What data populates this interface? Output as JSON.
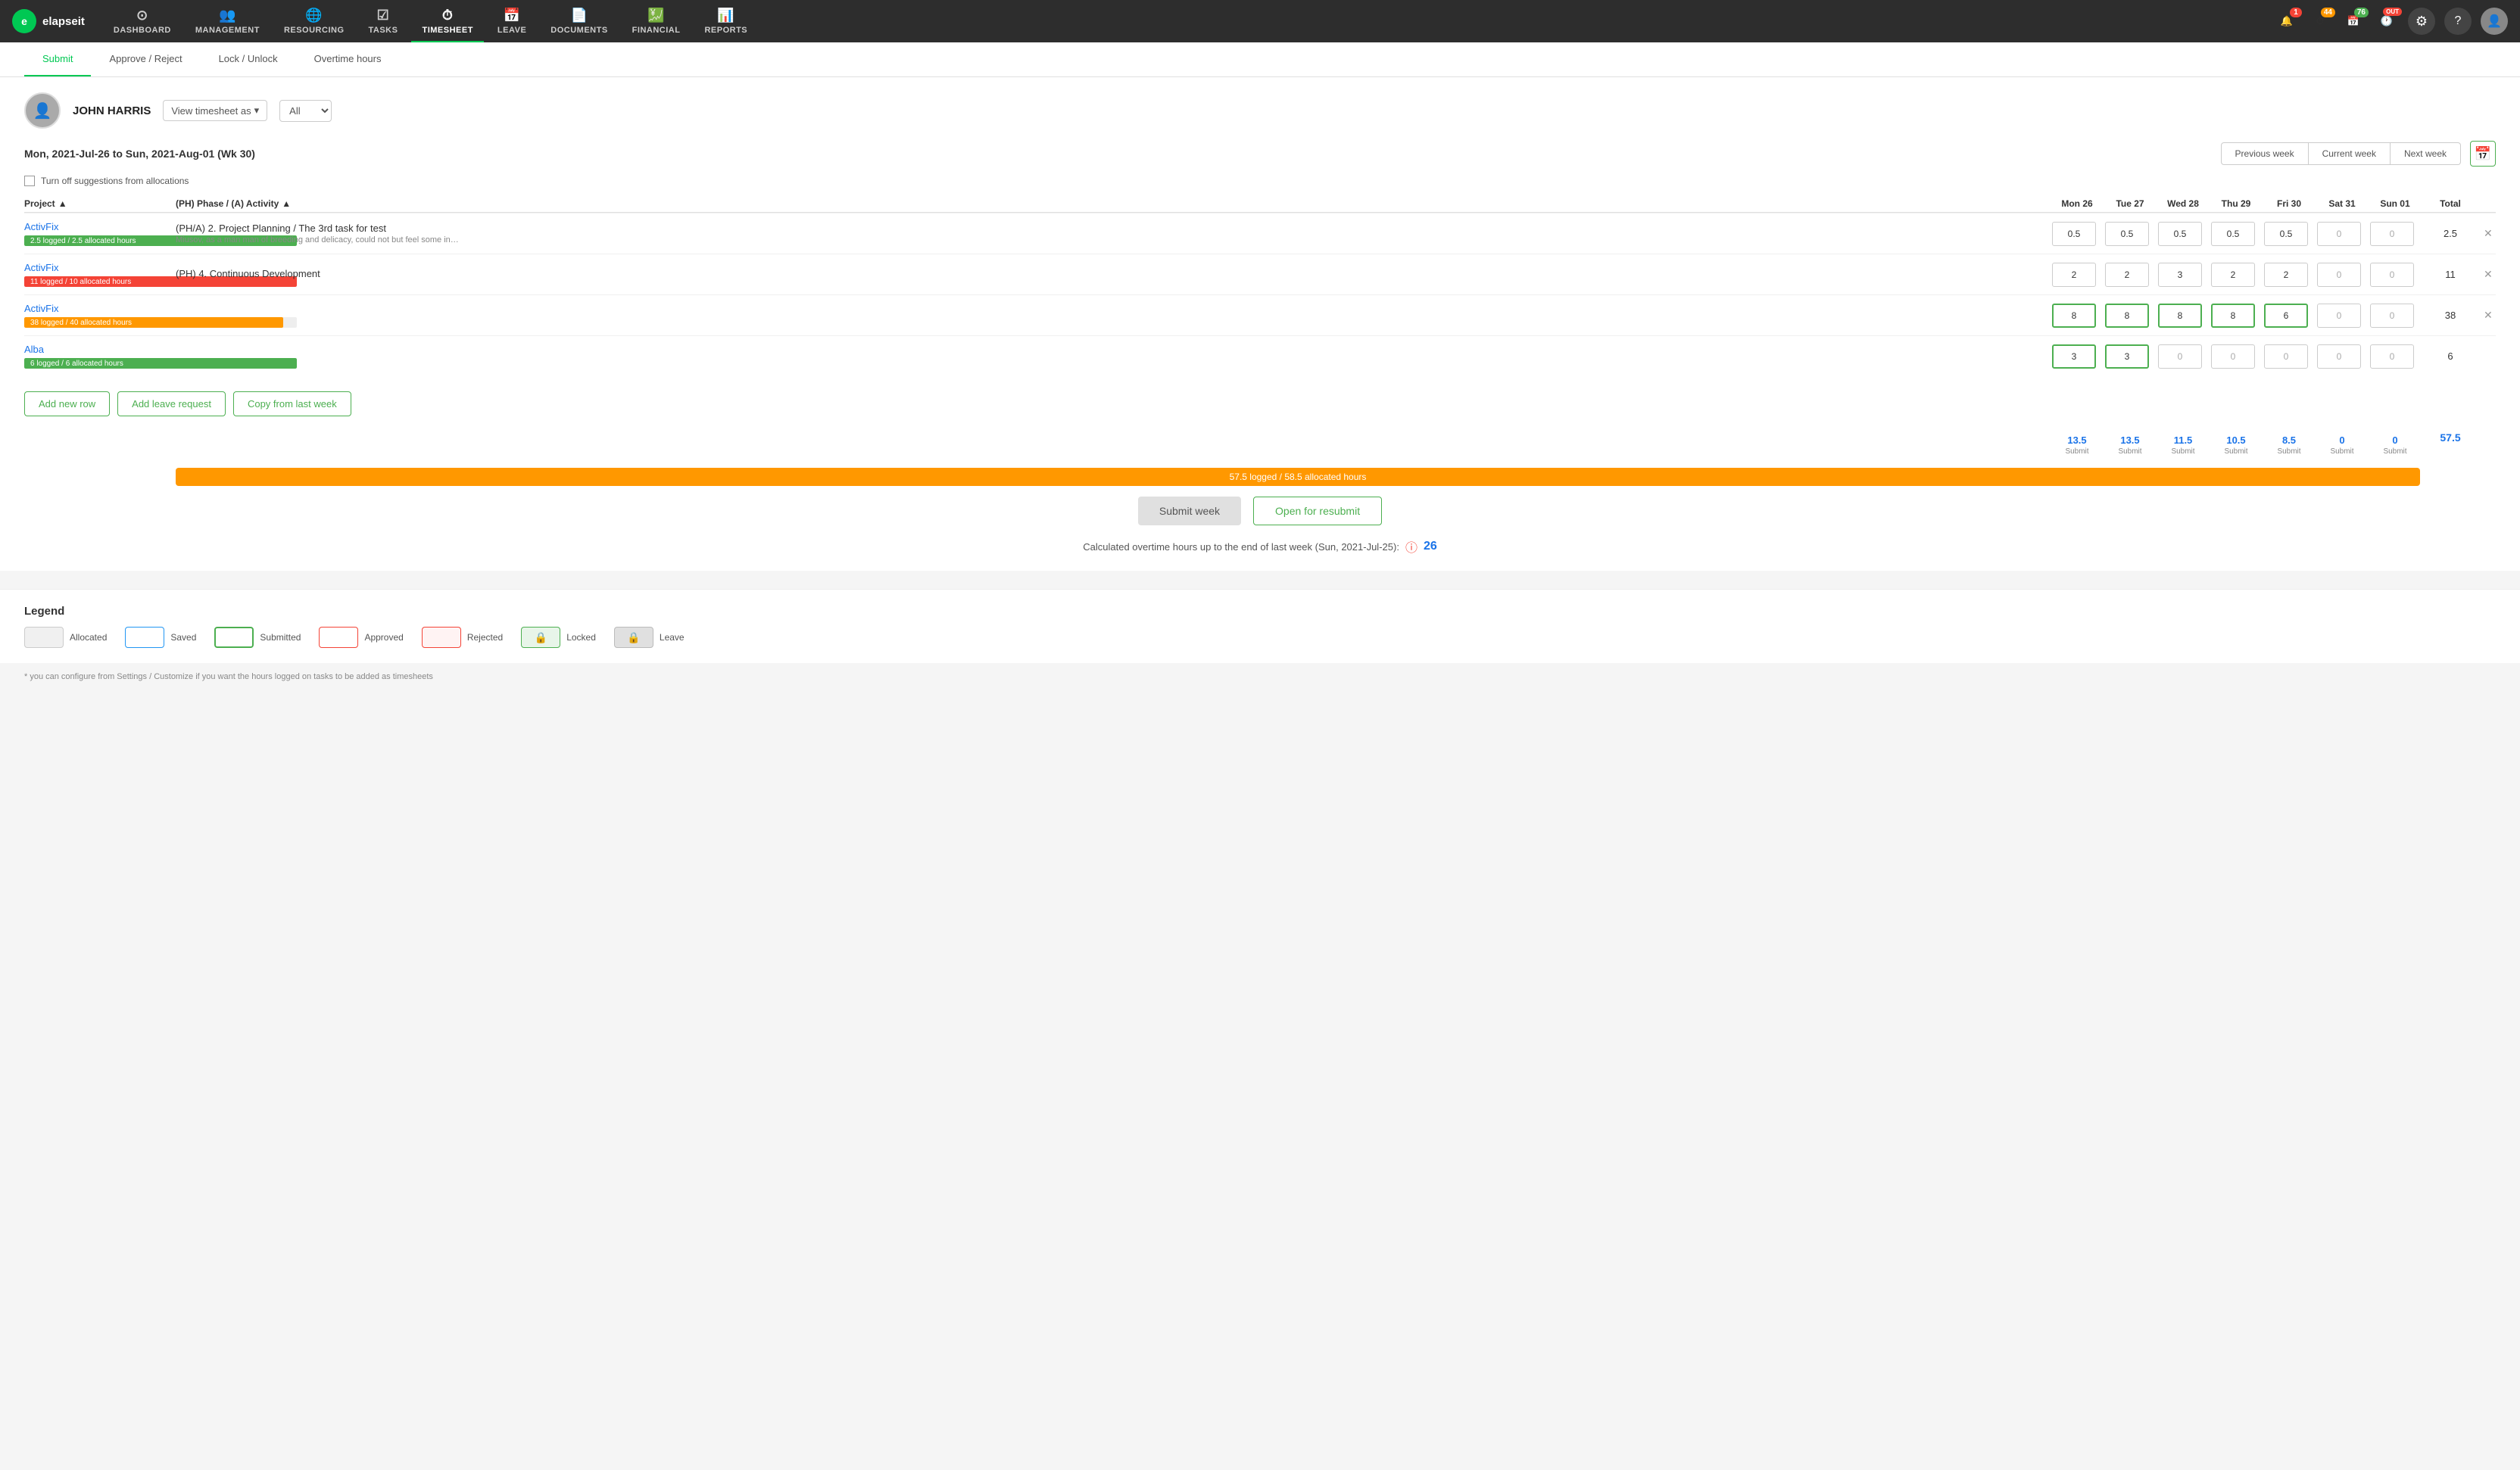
{
  "app": {
    "logo_text": "elapseit",
    "nav_items": [
      {
        "id": "dashboard",
        "label": "DASHBOARD",
        "icon": "⊙"
      },
      {
        "id": "management",
        "label": "MANAGEMENT",
        "icon": "👥"
      },
      {
        "id": "resourcing",
        "label": "RESOURCING",
        "icon": "🌐"
      },
      {
        "id": "tasks",
        "label": "TASKS",
        "icon": "☑"
      },
      {
        "id": "timesheet",
        "label": "TIMESHEET",
        "icon": "⏱",
        "active": true
      },
      {
        "id": "leave",
        "label": "LEAVE",
        "icon": "📅"
      },
      {
        "id": "documents",
        "label": "DOCUMENTS",
        "icon": "📄"
      },
      {
        "id": "financial",
        "label": "FINANCIAL",
        "icon": "💹"
      },
      {
        "id": "reports",
        "label": "REPORTS",
        "icon": "📊"
      }
    ],
    "nav_badges": [
      {
        "id": "bell",
        "count": "1",
        "color": "red"
      },
      {
        "id": "timer",
        "count": "44",
        "color": "orange"
      },
      {
        "id": "calendar",
        "count": "76",
        "color": "green"
      },
      {
        "id": "clock",
        "count": "OUT",
        "color": "red"
      }
    ]
  },
  "sub_nav": {
    "items": [
      {
        "id": "submit",
        "label": "Submit",
        "active": true
      },
      {
        "id": "approve-reject",
        "label": "Approve / Reject",
        "active": false
      },
      {
        "id": "lock-unlock",
        "label": "Lock / Unlock",
        "active": false
      },
      {
        "id": "overtime",
        "label": "Overtime hours",
        "active": false
      }
    ]
  },
  "user": {
    "name": "JOHN HARRIS",
    "view_as_label": "View timesheet as",
    "all_option": "All"
  },
  "week": {
    "title": "Mon, 2021-Jul-26 to Sun, 2021-Aug-01 (Wk 30)",
    "prev_label": "Previous week",
    "current_label": "Current week",
    "next_label": "Next week"
  },
  "suggestion": {
    "label": "Turn off suggestions from allocations"
  },
  "table": {
    "headers": {
      "project": "Project",
      "phase_activity": "(PH) Phase / (A) Activity",
      "days": [
        "Mon 26",
        "Tue 27",
        "Wed 28",
        "Thu 29",
        "Fri 30",
        "Sat 31",
        "Sun 01"
      ],
      "total": "Total"
    },
    "rows": [
      {
        "project": "ActivFix",
        "bar_label": "2.5 logged / 2.5 allocated hours",
        "bar_color": "green",
        "bar_pct": 100,
        "activity": "(PH/A) 2. Project Planning / The 3rd task for test",
        "activity_desc": "Miusov, as a man man of breeding and delicacy, could not but feel some inwrd qualms, when t",
        "hours": [
          "0.5",
          "0.5",
          "0.5",
          "0.5",
          "0.5",
          "0",
          "0"
        ],
        "total": "2.5",
        "input_style": "normal"
      },
      {
        "project": "ActivFix",
        "bar_label": "11 logged / 10 allocated hours",
        "bar_color": "red",
        "bar_pct": 100,
        "activity": "(PH) 4. Continuous Development",
        "activity_desc": "",
        "hours": [
          "2",
          "2",
          "3",
          "2",
          "2",
          "0",
          "0"
        ],
        "total": "11",
        "input_style": "normal"
      },
      {
        "project": "ActivFix",
        "bar_label": "38 logged / 40 allocated hours",
        "bar_color": "orange",
        "bar_pct": 95,
        "activity": "",
        "activity_desc": "",
        "hours": [
          "8",
          "8",
          "8",
          "8",
          "6",
          "0",
          "0"
        ],
        "total": "38",
        "input_style": "green"
      },
      {
        "project": "Alba",
        "bar_label": "6 logged / 6 allocated hours",
        "bar_color": "green",
        "bar_pct": 100,
        "activity": "",
        "activity_desc": "",
        "hours": [
          "3",
          "3",
          "0",
          "0",
          "0",
          "0",
          "0"
        ],
        "total": "6",
        "input_style": "green"
      }
    ],
    "day_totals": [
      "13.5",
      "13.5",
      "11.5",
      "10.5",
      "8.5",
      "0",
      "0"
    ],
    "week_total": "57.5"
  },
  "actions": {
    "add_row": "Add new row",
    "add_leave": "Add leave request",
    "copy_from_last": "Copy from last week"
  },
  "progress": {
    "label": "57.5 logged / 58.5 allocated hours",
    "pct": 98
  },
  "submit_buttons": {
    "submit_week": "Submit week",
    "open_resubmit": "Open for resubmit"
  },
  "overtime": {
    "label": "Calculated overtime hours up to the end of last week (Sun, 2021-Jul-25):",
    "value": "26"
  },
  "legend": {
    "title": "Legend",
    "items": [
      {
        "id": "allocated",
        "label": "Allocated",
        "style": "allocated"
      },
      {
        "id": "saved",
        "label": "Saved",
        "style": "saved"
      },
      {
        "id": "submitted",
        "label": "Submitted",
        "style": "submitted"
      },
      {
        "id": "approved",
        "label": "Approved",
        "style": "approved"
      },
      {
        "id": "rejected",
        "label": "Rejected",
        "style": "rejected"
      },
      {
        "id": "locked",
        "label": "Locked",
        "style": "locked",
        "icon": "🔒"
      },
      {
        "id": "leave",
        "label": "Leave",
        "style": "leave",
        "icon": "🔒"
      }
    ]
  },
  "footer": {
    "note": "* you can configure from Settings / Customize if you want the hours logged on tasks to be added as timesheets"
  }
}
